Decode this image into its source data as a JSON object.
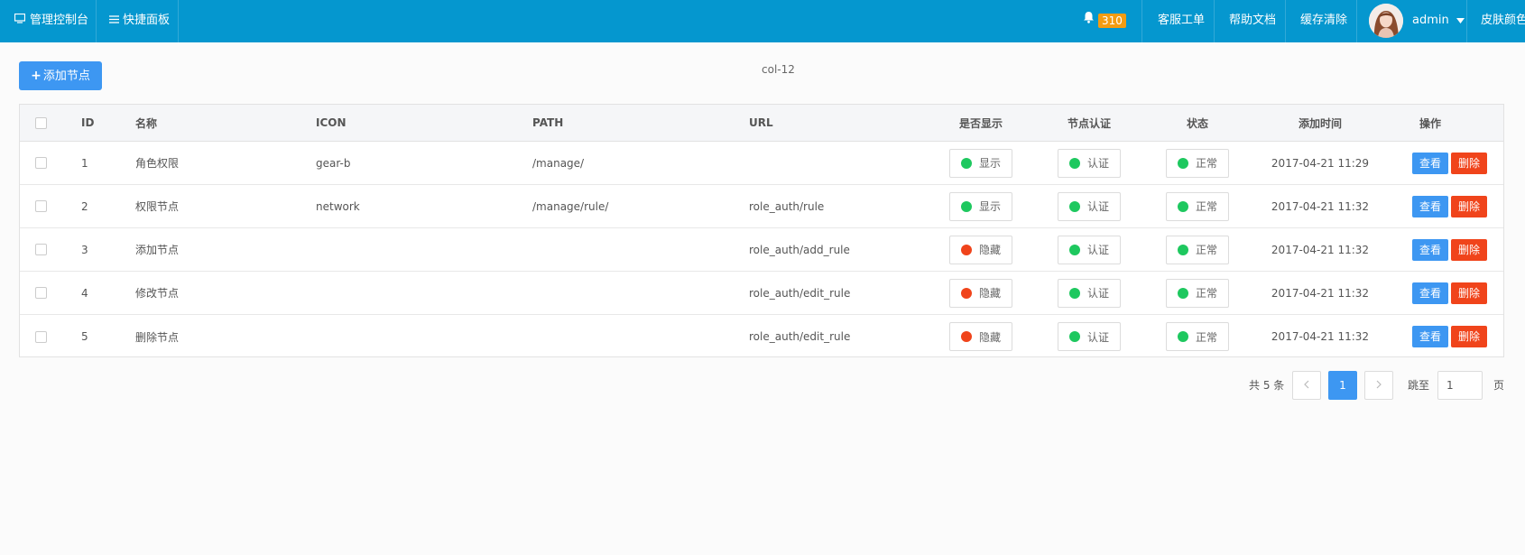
{
  "topbar": {
    "console_label": "管理控制台",
    "panel_label": "快捷面板",
    "notification_count": "310",
    "support_label": "客服工单",
    "help_label": "帮助文档",
    "cache_label": "缓存清除",
    "user_name": "admin",
    "skin_label": "皮肤颜色"
  },
  "toolbar": {
    "add_label": "添加节点",
    "col_label": "col-12"
  },
  "table": {
    "headers": [
      "ID",
      "名称",
      "ICON",
      "PATH",
      "URL",
      "是否显示",
      "节点认证",
      "状态",
      "添加时间",
      "操作"
    ],
    "rows": [
      {
        "id": "1",
        "name": "角色权限",
        "icon": "gear-b",
        "path": "/manage/",
        "url": "",
        "display": "显示",
        "auth": "认证",
        "status": "正常",
        "time": "2017-04-21 11:29"
      },
      {
        "id": "2",
        "name": "权限节点",
        "icon": "network",
        "path": "/manage/rule/",
        "url": "role_auth/rule",
        "display": "显示",
        "auth": "认证",
        "status": "正常",
        "time": "2017-04-21 11:32"
      },
      {
        "id": "3",
        "name": "添加节点",
        "icon": "",
        "path": "",
        "url": "role_auth/add_rule",
        "display": "隐藏",
        "auth": "认证",
        "status": "正常",
        "time": "2017-04-21 11:32"
      },
      {
        "id": "4",
        "name": "修改节点",
        "icon": "",
        "path": "",
        "url": "role_auth/edit_rule",
        "display": "隐藏",
        "auth": "认证",
        "status": "正常",
        "time": "2017-04-21 11:32"
      },
      {
        "id": "5",
        "name": "删除节点",
        "icon": "",
        "path": "",
        "url": "role_auth/edit_rule",
        "display": "隐藏",
        "auth": "认证",
        "status": "正常",
        "time": "2017-04-21 11:32"
      }
    ],
    "view_label": "查看",
    "delete_label": "删除"
  },
  "pagination": {
    "total_label": "共 5 条",
    "current_page": "1",
    "jump_label": "跳至",
    "jump_value": "1",
    "page_suffix": "页"
  },
  "colors": {
    "topbar": "#0597cf",
    "primary": "#3d97f2",
    "danger": "#f0441b",
    "success": "#1ec85f",
    "badge": "#f39c12"
  }
}
